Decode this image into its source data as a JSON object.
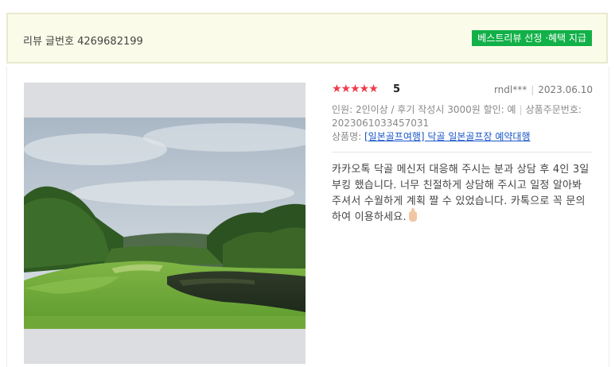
{
  "header": {
    "review_number": "리뷰 글번호 4269682199",
    "badge": "베스트리뷰 선정 ·혜택 지급"
  },
  "review": {
    "stars": "★★★★★",
    "score": "5",
    "writer": "rndl***",
    "date": "2023.06.10",
    "options": "인원: 2인이상 / 후기 작성시 3000원 할인: 예",
    "order_label": "상품주문번호:",
    "order_number": "2023061033457031",
    "product_label": "상품명:",
    "product_name": "[일본골프여행] 닥골 일본골프장 예약대행",
    "content": "카카오톡 닥골 메신저 대응해 주시는 분과 상담 후 4인 3일 부킹 했습니다. 너무 친절하게 상담해 주시고 일정 알아봐 주셔서 수월하게 계획 짤 수 있었습니다. 카톡으로 꼭 문의하여 이용하세요."
  },
  "colors": {
    "badge_bg": "#12b048",
    "star": "#ef3b4c",
    "link": "#1a56c8",
    "header_bg": "#fbfbe9"
  },
  "icons": {
    "content_emoji": "hand-icon"
  }
}
